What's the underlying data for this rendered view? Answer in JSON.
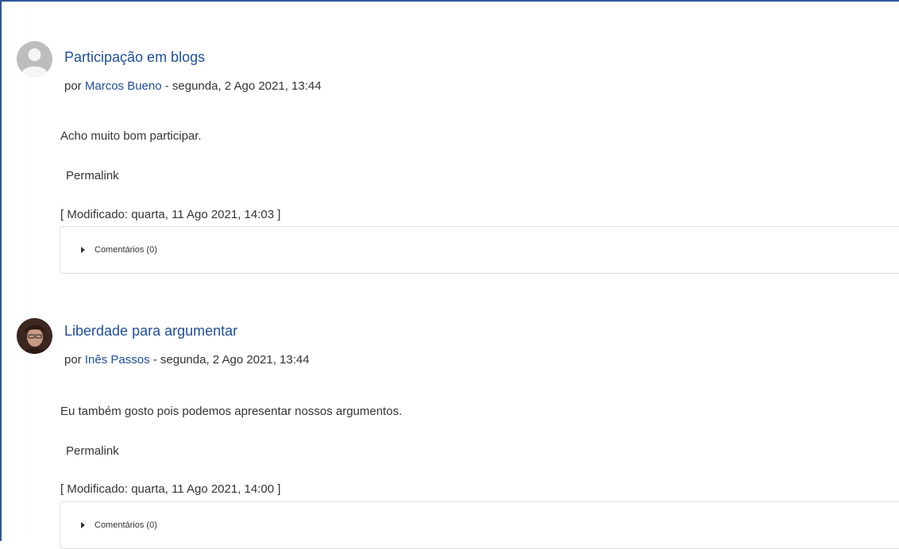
{
  "posts": [
    {
      "title": "Participação em blogs",
      "by_prefix": "por ",
      "author": "Marcos Bueno",
      "date": " - segunda, 2 Ago 2021, 13:44",
      "content": "Acho muito bom participar.",
      "permalink": "Permalink",
      "modified": "[ Modificado: quarta, 11 Ago 2021, 14:03 ]",
      "comments_label": "Comentários (0)",
      "avatar_icon": "default-user-avatar-icon"
    },
    {
      "title": "Liberdade para argumentar",
      "by_prefix": "por ",
      "author": "Inês Passos",
      "date": " - segunda, 2 Ago 2021, 13:44",
      "content": "Eu também gosto pois podemos apresentar nossos argumentos.",
      "permalink": "Permalink",
      "modified": "[ Modificado: quarta, 11 Ago 2021, 14:00 ]",
      "comments_label": "Comentários (0)",
      "avatar_icon": "user-photo-avatar"
    }
  ],
  "colors": {
    "link": "#1f4e9c",
    "frame": "#2f5597",
    "text": "#333333"
  }
}
